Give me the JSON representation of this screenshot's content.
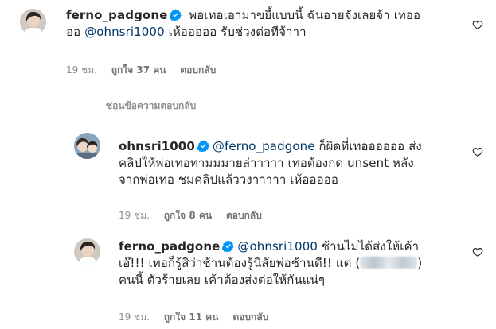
{
  "comments": [
    {
      "username": "ferno_padgone",
      "text_before": " พอเทอเอามาขยี้แบบนี้ ฉันอายจังเลยจ้า เทออ",
      "text_line2_pre": "ออ ",
      "mention": "@ohnsri1000",
      "text_after": " เห้อออออ รับช่วงต่อทีจ้าาา",
      "time": "19 ชม.",
      "likes": "ถูกใจ 37 คน",
      "reply_label": "ตอบกลับ"
    },
    {
      "username": "ohnsri1000",
      "mention": "@ferno_padgone",
      "line1_after": " ก็ผิดที่เทออออออ ส่ง",
      "line2": "คลิปให้พ่อเทอทามมมายล่าาาาา เทอต้องกด unsent หลัง",
      "line3": "จากพ่อเทอ ชมคลิปแล้ววงาาาาา เห้อออออ",
      "time": "19 ชม.",
      "likes": "ถูกใจ 8 คน",
      "reply_label": "ตอบกลับ"
    },
    {
      "username": "ferno_padgone",
      "mention": "@ohnsri1000",
      "line1_after": " ช้านไม่ได้ส่งให้เค้า",
      "line2_pre": "เอ๊!!! เทอก็รู้สิว่าช้านต้องรู้นิสัยพ่อช้านดี!! แต่ (",
      "line2_post": ")",
      "line3": "คนนี้ ตัวร้ายเลย เค้าต้องส่งต่อให้กันแน่ๆ",
      "time": "19 ชม.",
      "likes": "ถูกใจ 11 คน",
      "reply_label": "ตอบกลับ"
    }
  ],
  "hide_replies_label": "ซ่อนข้อความตอบกลับ",
  "colors": {
    "verified": "#0095f6",
    "mention": "#00376b",
    "meta": "#8e8e8e"
  },
  "icons": {
    "like": "heart-outline-icon",
    "verified": "verified-badge-icon"
  }
}
